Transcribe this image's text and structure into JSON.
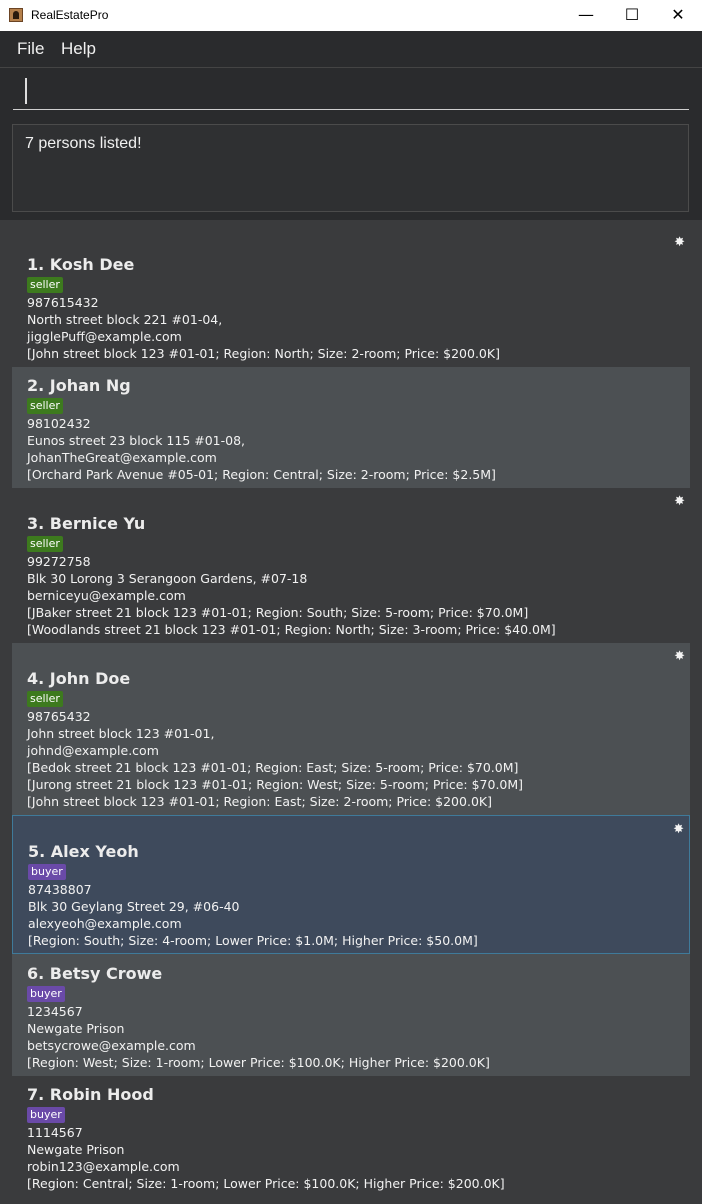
{
  "window": {
    "title": "RealEstatePro",
    "minimize": "—",
    "maximize": "☐",
    "close": "✕"
  },
  "menu": {
    "file": "File",
    "help": "Help"
  },
  "command": {
    "value": "",
    "placeholder": ""
  },
  "result": {
    "text": "7 persons listed!"
  },
  "icons": {
    "favourite": "burst-icon"
  },
  "persons": [
    {
      "name": "1.  Kosh Dee",
      "tag": "seller",
      "phone": "987615432",
      "address": "North street block 221 #01-04,",
      "email": "jigglePuff@example.com",
      "props": [
        "[John street block 123 #01-01; Region: North; Size: 2-room; Price: $200.0K]"
      ],
      "favourite": true
    },
    {
      "name": "2.  Johan Ng",
      "tag": "seller",
      "phone": "98102432",
      "address": "Eunos street 23 block 115 #01-08,",
      "email": "JohanTheGreat@example.com",
      "props": [
        "[Orchard Park Avenue #05-01; Region: Central; Size: 2-room; Price: $2.5M]"
      ],
      "favourite": false
    },
    {
      "name": "3.  Bernice Yu",
      "tag": "seller",
      "phone": "99272758",
      "address": "Blk 30 Lorong 3 Serangoon Gardens, #07-18",
      "email": "berniceyu@example.com",
      "props": [
        "[JBaker street 21 block 123 #01-01; Region: South; Size: 5-room; Price: $70.0M]",
        "[Woodlands street 21 block 123 #01-01; Region: North; Size: 3-room; Price: $40.0M]"
      ],
      "favourite": true
    },
    {
      "name": "4.  John Doe",
      "tag": "seller",
      "phone": "98765432",
      "address": "John street block 123 #01-01,",
      "email": "johnd@example.com",
      "props": [
        "[Bedok street 21 block 123 #01-01; Region: East; Size: 5-room; Price: $70.0M]",
        "[Jurong street 21 block 123 #01-01; Region: West; Size: 5-room; Price: $70.0M]",
        "[John street block 123 #01-01; Region: East; Size: 2-room; Price: $200.0K]"
      ],
      "favourite": true
    },
    {
      "name": "5.  Alex Yeoh",
      "tag": "buyer",
      "phone": "87438807",
      "address": "Blk 30 Geylang Street 29, #06-40",
      "email": "alexyeoh@example.com",
      "props": [
        "[Region: South; Size: 4-room; Lower Price: $1.0M; Higher Price: $50.0M]"
      ],
      "favourite": true
    },
    {
      "name": "6.  Betsy Crowe",
      "tag": "buyer",
      "phone": "1234567",
      "address": "Newgate Prison",
      "email": "betsycrowe@example.com",
      "props": [
        "[Region: West; Size: 1-room; Lower Price: $100.0K; Higher Price: $200.0K]"
      ],
      "favourite": false
    },
    {
      "name": "7.  Robin Hood",
      "tag": "buyer",
      "phone": "1114567",
      "address": "Newgate Prison",
      "email": "robin123@example.com",
      "props": [
        "[Region: Central; Size: 1-room; Lower Price: $100.0K; Higher Price: $200.0K]"
      ],
      "favourite": false
    }
  ]
}
